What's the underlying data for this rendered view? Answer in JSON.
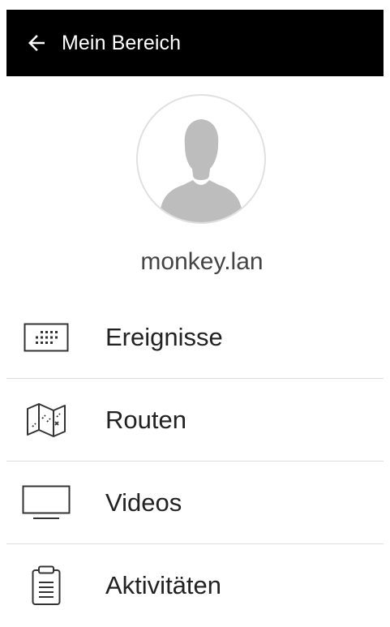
{
  "header": {
    "title": "Mein Bereich",
    "back_icon": "arrow-left-icon",
    "background": "#000000",
    "text_color": "#ffffff"
  },
  "profile": {
    "avatar_icon": "person-silhouette-icon",
    "username": "monkey.lan"
  },
  "menu": {
    "items": [
      {
        "label": "Ereignisse",
        "icon": "calendar-grid-icon"
      },
      {
        "label": "Routen",
        "icon": "map-icon"
      },
      {
        "label": "Videos",
        "icon": "monitor-icon"
      },
      {
        "label": "Aktivitäten",
        "icon": "clipboard-icon"
      }
    ]
  }
}
